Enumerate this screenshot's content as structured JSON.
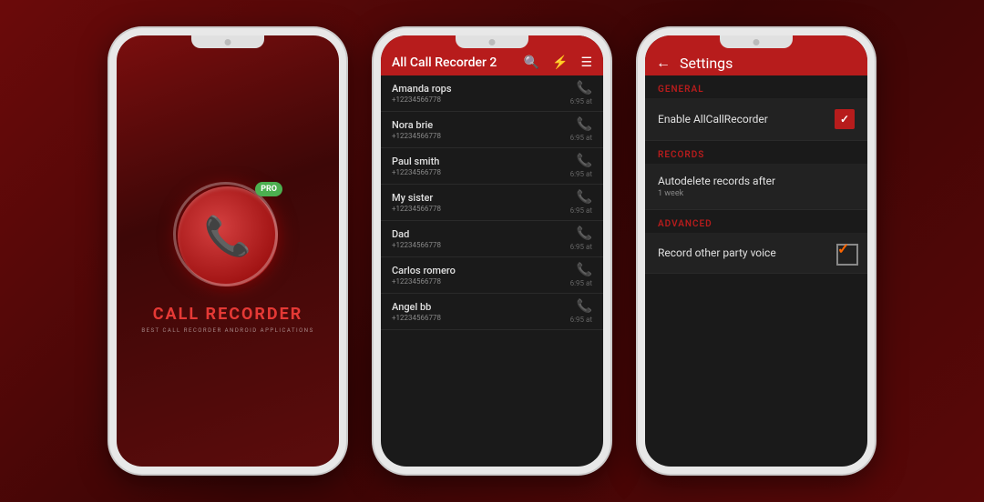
{
  "background": {
    "color": "#5a0808"
  },
  "phone1": {
    "logo": {
      "pro_badge": "PRO",
      "phone_symbol": "📞"
    },
    "app_name_part1": "CALL",
    "app_name_highlight": " RECORDER",
    "subtitle": "BEST CALL RECORDER ANDROID APPLICATIONS"
  },
  "phone2": {
    "appbar": {
      "title": "All Call Recorder 2",
      "icons": [
        "search",
        "flash",
        "menu"
      ]
    },
    "calls": [
      {
        "name": "Amanda rops",
        "number": "+12234566778",
        "time": "6:95 at",
        "type": "incoming"
      },
      {
        "name": "Nora brie",
        "number": "+12234566778",
        "time": "6:95 at",
        "type": "outgoing"
      },
      {
        "name": "Paul smith",
        "number": "+12234566778",
        "time": "6:95 at",
        "type": "incoming"
      },
      {
        "name": "My sister",
        "number": "+12234566778",
        "time": "6:95 at",
        "type": "outgoing"
      },
      {
        "name": "Dad",
        "number": "+12234566778",
        "time": "6:95 at",
        "type": "incoming"
      },
      {
        "name": "Carlos romero",
        "number": "+12234566778",
        "time": "6:95 at",
        "type": "outgoing"
      },
      {
        "name": "Angel bb",
        "number": "+12234566778",
        "time": "6:95 at",
        "type": "incoming"
      }
    ]
  },
  "phone3": {
    "appbar": {
      "back_label": "←",
      "title": "Settings"
    },
    "sections": [
      {
        "header": "GENERAL",
        "items": [
          {
            "label": "Enable AllCallRecorder",
            "subtext": "",
            "checked": true
          }
        ]
      },
      {
        "header": "RECORDS",
        "items": [
          {
            "label": "Autodelete records after",
            "subtext": "1 week",
            "checked": false
          }
        ]
      },
      {
        "header": "ADVANCED",
        "items": [
          {
            "label": "Record other party voice",
            "subtext": "",
            "checked": true
          }
        ]
      }
    ]
  }
}
